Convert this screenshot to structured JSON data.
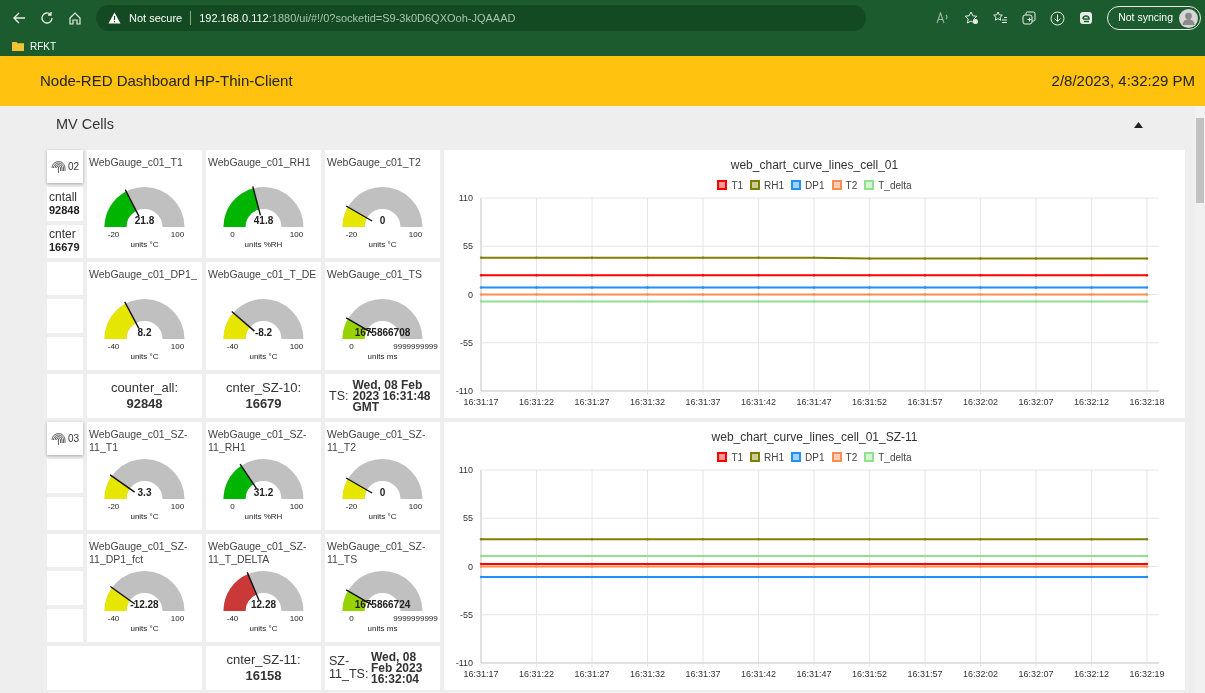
{
  "browser": {
    "security": "Not secure",
    "url_host": "192.168.0.112",
    "url_rest": ":1880/ui/#!/0?socketid=S9-3k0D6QXOoh-JQAAAD",
    "sync": "Not syncing",
    "bookmarks": [
      {
        "label": "RFKT"
      }
    ]
  },
  "header": {
    "title": "Node-RED Dashboard HP-Thin-Client",
    "datetime": "2/8/2023, 4:32:29 PM"
  },
  "group": {
    "title": "MV Cells",
    "expanded": true
  },
  "sections": [
    {
      "button": {
        "label": "02"
      },
      "counters": [
        {
          "label": "cntall",
          "value": "92848"
        },
        {
          "label": "cnter",
          "value": "16679"
        }
      ],
      "gauges": [
        {
          "title": "WebGauge_c01_T1",
          "value": "21.8",
          "units": "units °C",
          "min": "-20",
          "max": "100",
          "color": "#00b500"
        },
        {
          "title": "WebGauge_c01_RH1",
          "value": "41.8",
          "units": "units %RH",
          "min": "0",
          "max": "100",
          "color": "#00b500"
        },
        {
          "title": "WebGauge_c01_T2",
          "value": "0",
          "units": "units °C",
          "min": "-20",
          "max": "100",
          "color": "#e6e600"
        },
        {
          "title": "WebGauge_c01_DP1_",
          "value": "8.2",
          "units": "units °C",
          "min": "-40",
          "max": "100",
          "color": "#e6e600"
        },
        {
          "title": "WebGauge_c01_T_DE",
          "value": "-8.2",
          "units": "units °C",
          "min": "-40",
          "max": "100",
          "color": "#e6e600"
        },
        {
          "title": "WebGauge_c01_TS",
          "value": "1675866708",
          "units": "units ms",
          "min": "0",
          "max": "9999999999",
          "color": "#97d300"
        }
      ],
      "text_widgets": [
        {
          "kind": "stacked",
          "label": "counter_all:",
          "value": "92848"
        },
        {
          "kind": "stacked",
          "label": "cnter_SZ-10:",
          "value": "16679"
        },
        {
          "kind": "inline",
          "label": "TS:",
          "value": "Wed, 08 Feb 2023 16:31:48 GMT"
        }
      ],
      "chart_data": {
        "type": "line",
        "title": "web_chart_curve_lines_cell_01",
        "grid": true,
        "legend": "top",
        "ylim": [
          -110,
          110
        ],
        "yticks": [
          -110,
          -55,
          0,
          55,
          110
        ],
        "categories": [
          "16:31:17",
          "16:31:22",
          "16:31:27",
          "16:31:32",
          "16:31:37",
          "16:31:42",
          "16:31:47",
          "16:31:52",
          "16:31:57",
          "16:32:02",
          "16:32:07",
          "16:32:12",
          "16:32:18"
        ],
        "series": [
          {
            "name": "T1",
            "color": "#ff0000",
            "values": [
              22,
              22,
              22,
              22,
              22,
              22,
              22,
              22,
              22,
              22,
              22,
              22,
              22
            ]
          },
          {
            "name": "RH1",
            "color": "#808000",
            "values": [
              42,
              42,
              42,
              42,
              42,
              42,
              42,
              41,
              41,
              41,
              41,
              41,
              41
            ]
          },
          {
            "name": "DP1",
            "color": "#1e90ff",
            "values": [
              8,
              8,
              8,
              8,
              8,
              8,
              8,
              8,
              8,
              8,
              8,
              8,
              8
            ]
          },
          {
            "name": "T2",
            "color": "#ff8c50",
            "values": [
              0,
              0,
              0,
              0,
              0,
              0,
              0,
              0,
              0,
              0,
              0,
              0,
              0
            ]
          },
          {
            "name": "T_delta",
            "color": "#90e090",
            "values": [
              -8,
              -8,
              -8,
              -8,
              -8,
              -8,
              -8,
              -8,
              -8,
              -8,
              -8,
              -8,
              -8
            ]
          }
        ]
      }
    },
    {
      "button": {
        "label": "03"
      },
      "gauges": [
        {
          "title": "WebGauge_c01_SZ-11_T1",
          "value": "3.3",
          "units": "units °C",
          "min": "-20",
          "max": "100",
          "color": "#e6e600"
        },
        {
          "title": "WebGauge_c01_SZ-11_RH1",
          "value": "31.2",
          "units": "units %RH",
          "min": "0",
          "max": "100",
          "color": "#00b500"
        },
        {
          "title": "WebGauge_c01_SZ-11_T2",
          "value": "0",
          "units": "units °C",
          "min": "-20",
          "max": "100",
          "color": "#e6e600"
        },
        {
          "title": "WebGauge_c01_SZ-11_DP1_fct",
          "value": "-12.28",
          "units": "units °C",
          "min": "-40",
          "max": "100",
          "color": "#e6e600"
        },
        {
          "title": "WebGauge_c01_SZ-11_T_DELTA",
          "value": "12.28",
          "units": "units °C",
          "min": "-40",
          "max": "100",
          "color": "#ca3838"
        },
        {
          "title": "WebGauge_c01_SZ-11_TS",
          "value": "1675866724",
          "units": "units ms",
          "min": "0",
          "max": "9999999999",
          "color": "#97d300"
        }
      ],
      "text_widgets": [
        {
          "kind": "stacked",
          "label": "cnter_SZ-11:",
          "value": "16158"
        },
        {
          "kind": "inline",
          "label": "SZ-11_TS:",
          "value": "Wed, 08 Feb 2023 16:32:04"
        }
      ],
      "chart_data": {
        "type": "line",
        "title": "web_chart_curve_lines_cell_01_SZ-11",
        "grid": true,
        "legend": "top",
        "ylim": [
          -110,
          110
        ],
        "yticks": [
          -110,
          -55,
          0,
          55,
          110
        ],
        "categories": [
          "16:31:17",
          "16:31:22",
          "16:31:27",
          "16:31:32",
          "16:31:37",
          "16:31:42",
          "16:31:47",
          "16:31:52",
          "16:31:57",
          "16:32:02",
          "16:32:07",
          "16:32:12",
          "16:32:19"
        ],
        "series": [
          {
            "name": "T1",
            "color": "#ff0000",
            "values": [
              3,
              3,
              3,
              3,
              3,
              3,
              3,
              3,
              3,
              3,
              3,
              3,
              3
            ]
          },
          {
            "name": "RH1",
            "color": "#808000",
            "values": [
              31,
              31,
              31,
              31,
              31,
              31,
              31,
              31,
              31,
              31,
              31,
              31,
              31
            ]
          },
          {
            "name": "DP1",
            "color": "#1e90ff",
            "values": [
              -12,
              -12,
              -12,
              -12,
              -12,
              -12,
              -12,
              -12,
              -12,
              -12,
              -12,
              -12,
              -12
            ]
          },
          {
            "name": "T2",
            "color": "#ff8c50",
            "values": [
              0,
              0,
              0,
              0,
              0,
              0,
              0,
              0,
              0,
              0,
              0,
              0,
              0
            ]
          },
          {
            "name": "T_delta",
            "color": "#90e090",
            "values": [
              12,
              12,
              12,
              12,
              12,
              12,
              12,
              12,
              12,
              12,
              12,
              12,
              12
            ]
          }
        ]
      }
    }
  ]
}
